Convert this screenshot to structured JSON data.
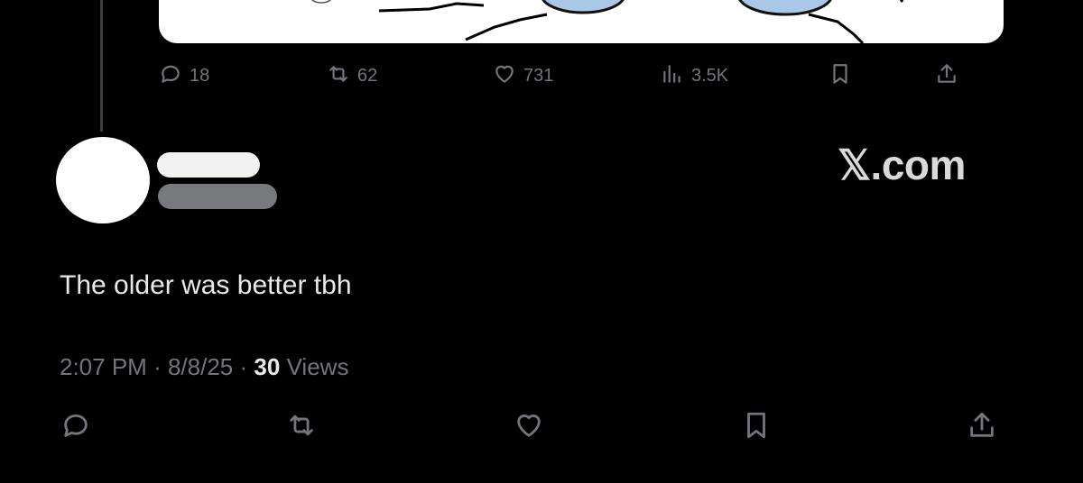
{
  "previous_post": {
    "reply_count": "18",
    "repost_count": "62",
    "like_count": "731",
    "view_count": "3.5K"
  },
  "reply_post": {
    "brand": "𝕏.com",
    "text": "The older was better tbh",
    "time": "2:07 PM",
    "date": "8/8/25",
    "views_number": "30",
    "views_label": "Views",
    "separator": "·"
  },
  "icons": [
    "reply-icon",
    "repost-icon",
    "like-icon",
    "views-icon",
    "bookmark-icon",
    "share-icon"
  ],
  "colors": {
    "background": "#000000",
    "text": "#e7e9ea",
    "muted": "#71767b",
    "media_blue": "#a9c7e6"
  }
}
